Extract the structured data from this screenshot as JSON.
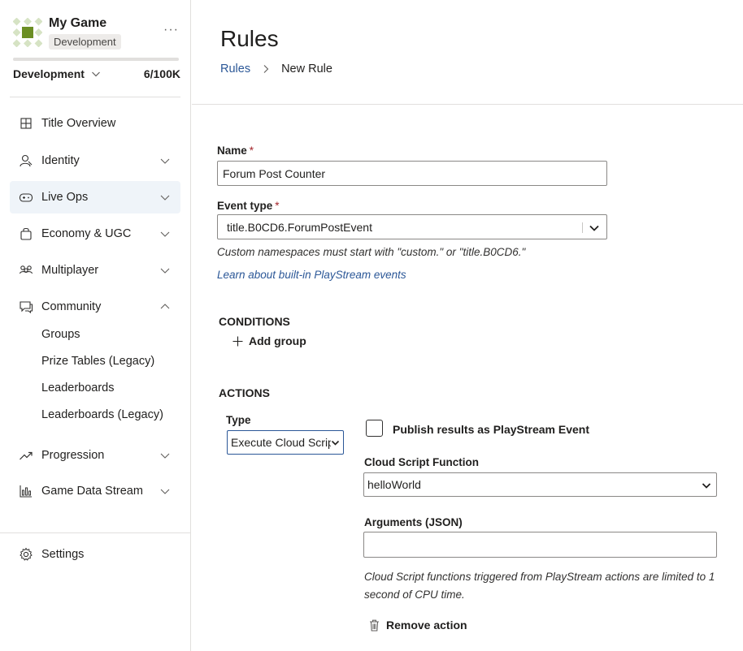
{
  "sidebar": {
    "game_name": "My Game",
    "environment_badge": "Development",
    "more_label": "···",
    "environment_select": "Development",
    "usage_count": "6/100K",
    "usage_fraction": 0.0,
    "items": [
      {
        "label": "Title Overview",
        "icon": "grid-icon"
      },
      {
        "label": "Identity",
        "icon": "person-icon"
      },
      {
        "label": "Live Ops",
        "icon": "gamepad-icon"
      },
      {
        "label": "Economy & UGC",
        "icon": "bag-icon"
      },
      {
        "label": "Multiplayer",
        "icon": "people-icon"
      },
      {
        "label": "Community",
        "icon": "chat-icon"
      },
      {
        "label": "Progression",
        "icon": "trend-icon"
      },
      {
        "label": "Game Data Stream",
        "icon": "bar-chart-icon"
      },
      {
        "label": "Settings",
        "icon": "gear-icon"
      }
    ],
    "community_subitems": [
      "Groups",
      "Prize Tables (Legacy)",
      "Leaderboards",
      "Leaderboards (Legacy)"
    ]
  },
  "header": {
    "title": "Rules",
    "breadcrumb": [
      "Rules",
      "New Rule"
    ]
  },
  "form": {
    "name_label": "Name",
    "name_required": "*",
    "name_value": "Forum Post Counter",
    "event_type_label": "Event type",
    "event_type_required": "*",
    "event_type_value": "title.B0CD6.ForumPostEvent",
    "namespace_hint": "Custom namespaces must start with \"custom.\" or \"title.B0CD6.\"",
    "learn_link": "Learn about built-in PlayStream events"
  },
  "conditions": {
    "title": "CONDITIONS",
    "add_group": "Add group"
  },
  "actions": {
    "title": "ACTIONS",
    "type_label": "Type",
    "type_value": "Execute Cloud Script",
    "publish_label": "Publish results as PlayStream Event",
    "publish_checked": false,
    "function_label": "Cloud Script Function",
    "function_value": "helloWorld",
    "arguments_label": "Arguments (JSON)",
    "arguments_value": "",
    "cpu_hint": "Cloud Script functions triggered from PlayStream actions are limited to 1 second of CPU time.",
    "remove_label": "Remove action"
  },
  "colors": {
    "accent": "#2b5797",
    "required": "#a4262c",
    "active_nav_bg": "#eff4f9",
    "logo_green": "#6b8e23"
  }
}
